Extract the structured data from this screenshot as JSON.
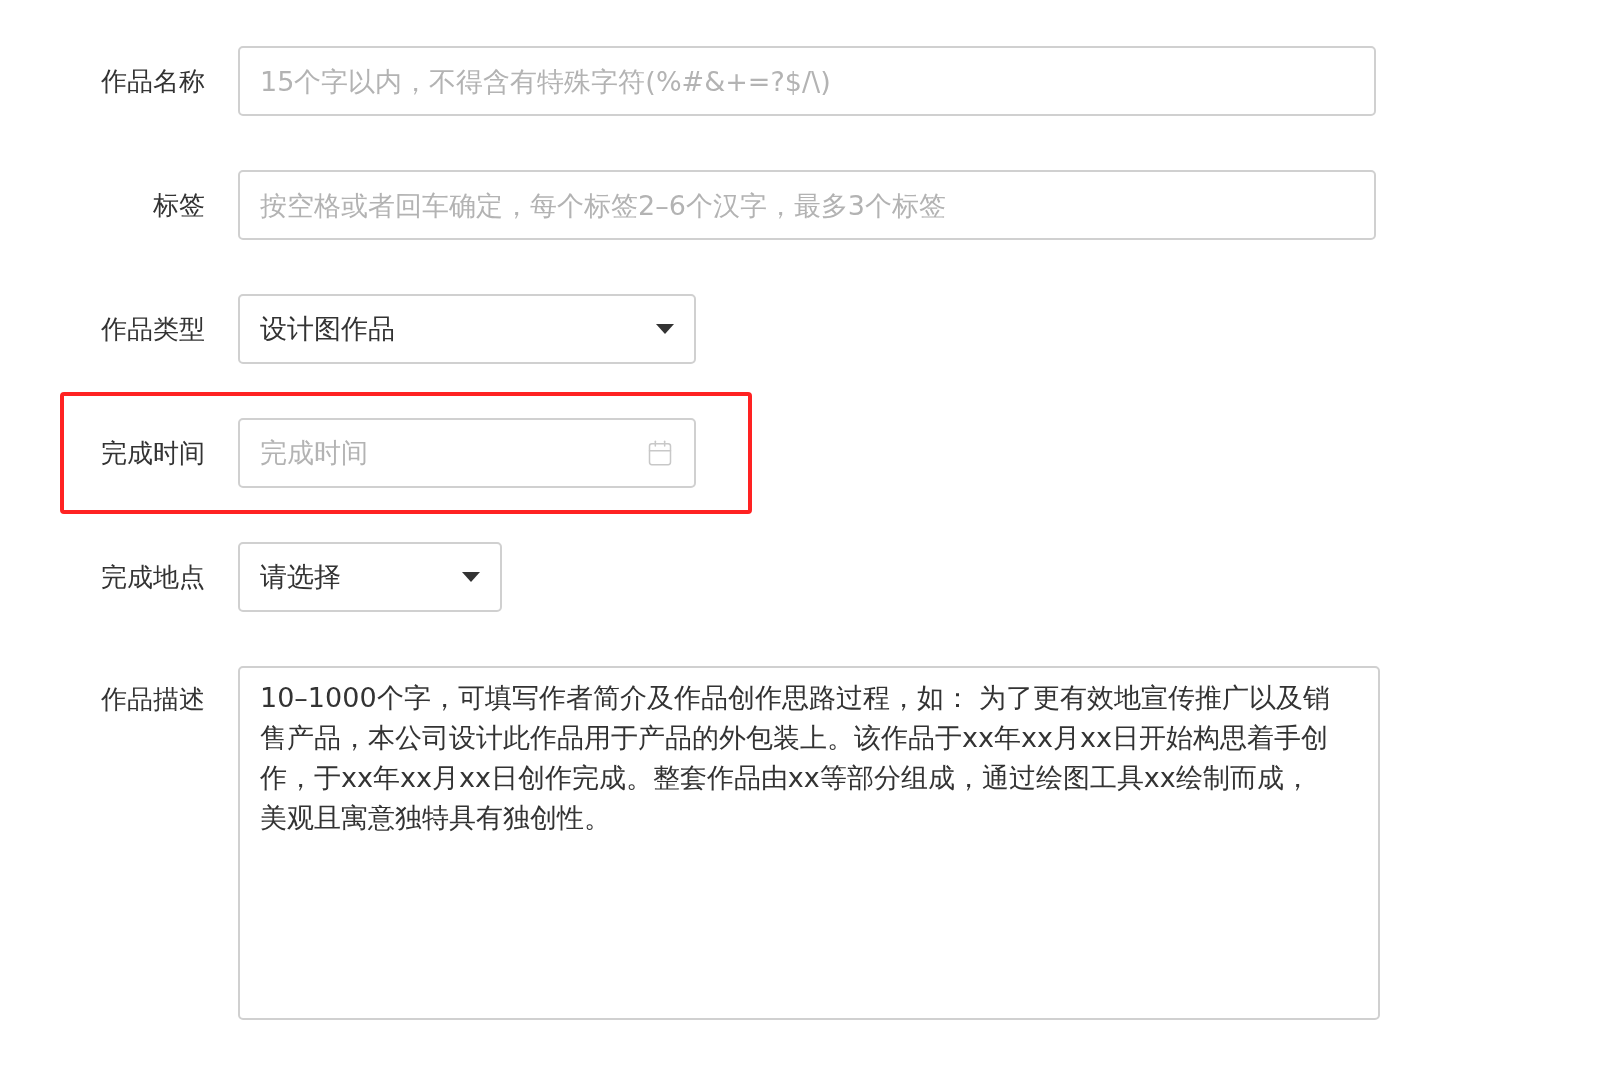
{
  "fields": [
    {
      "kind": "text",
      "label": "作品名称",
      "placeholder": "15个字以内，不得含有特殊字符(%#&+=?$/\\)",
      "highlighted": false
    },
    {
      "kind": "text",
      "label": "标签",
      "placeholder": "按空格或者回车确定，每个标签2–6个汉字，最多3个标签",
      "highlighted": false
    },
    {
      "kind": "select",
      "label": "作品类型",
      "value": "设计图作品",
      "highlighted": false
    },
    {
      "kind": "date",
      "label": "完成时间",
      "placeholder": "完成时间",
      "highlighted": true
    },
    {
      "kind": "select_small",
      "label": "完成地点",
      "value": "请选择",
      "highlighted": false
    },
    {
      "kind": "textarea",
      "label": "作品描述",
      "value": "10–1000个字，可填写作者简介及作品创作思路过程，如： 为了更有效地宣传推广以及销售产品，本公司设计此作品用于产品的外包装上。该作品于xx年xx月xx日开始构思着手创作，于xx年xx月xx日创作完成。整套作品由xx等部分组成，通过绘图工具xx绘制而成，美观且寓意独特具有独创性。",
      "highlighted": false
    }
  ]
}
